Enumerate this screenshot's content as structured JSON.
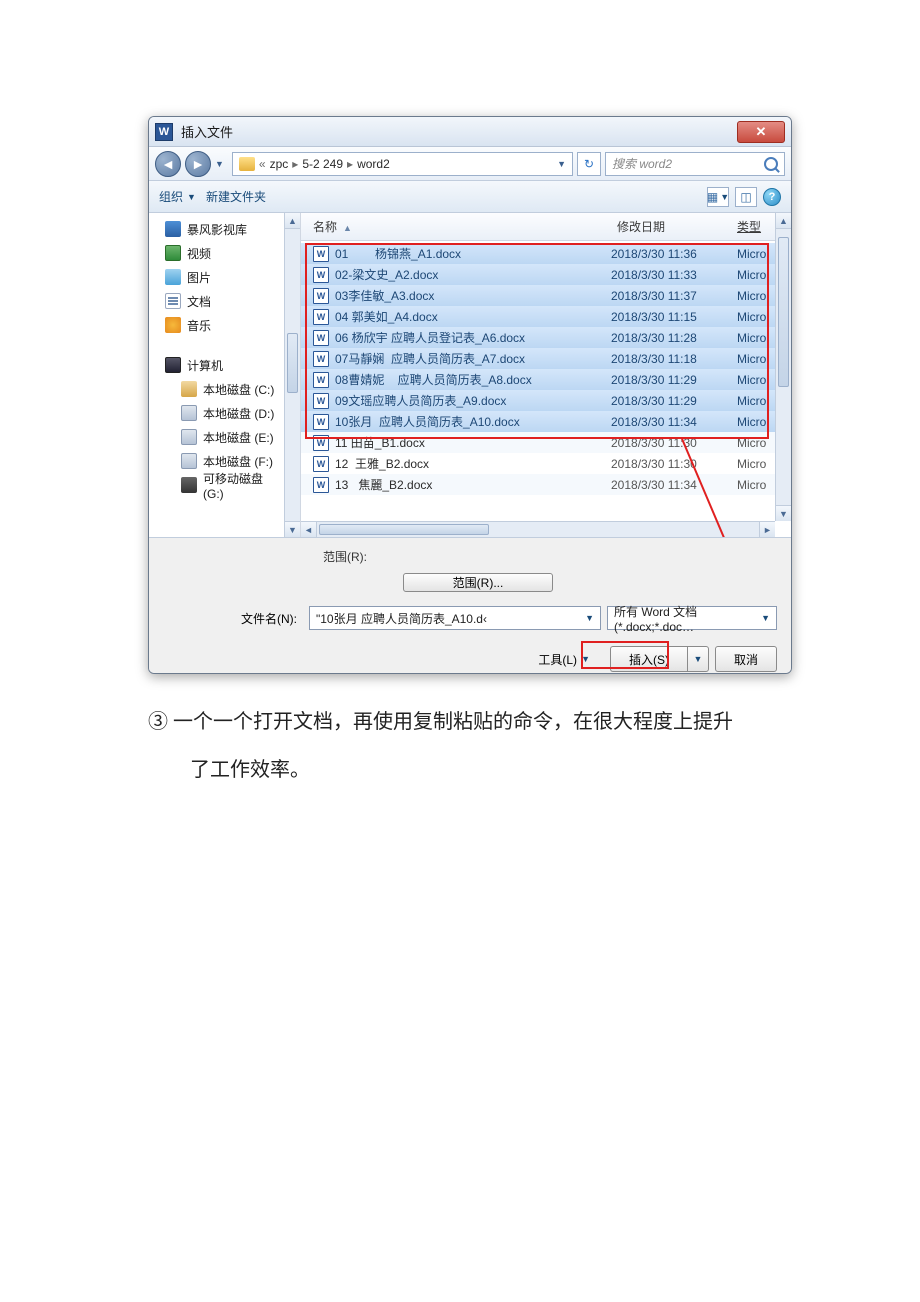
{
  "titlebar": {
    "app_label": "W",
    "title": "插入文件"
  },
  "nav": {
    "path_segments": [
      "zpc",
      "5-2 249",
      "word2"
    ],
    "search_placeholder": "搜索 word2"
  },
  "toolbar": {
    "organize": "组织",
    "new_folder": "新建文件夹"
  },
  "sidebar": {
    "items": [
      {
        "label": "暴风影视库",
        "icon": "ico-video",
        "indent": false
      },
      {
        "label": "视频",
        "icon": "ico-vid2",
        "indent": false
      },
      {
        "label": "图片",
        "icon": "ico-img",
        "indent": false
      },
      {
        "label": "文档",
        "icon": "ico-doc",
        "indent": false
      },
      {
        "label": "音乐",
        "icon": "ico-mus",
        "indent": false
      }
    ],
    "computer_label": "计算机",
    "drives": [
      {
        "label": "本地磁盘 (C:)",
        "icon": "ico-c"
      },
      {
        "label": "本地磁盘 (D:)",
        "icon": "ico-hdd"
      },
      {
        "label": "本地磁盘 (E:)",
        "icon": "ico-hdd"
      },
      {
        "label": "本地磁盘 (F:)",
        "icon": "ico-hdd"
      },
      {
        "label": "可移动磁盘 (G:)",
        "icon": "ico-usb"
      }
    ]
  },
  "filehead": {
    "name": "名称",
    "date": "修改日期",
    "type": "类型"
  },
  "files": [
    {
      "name": "01        杨锦燕_A1.docx",
      "date": "2018/3/30 11:36",
      "type": "Micro",
      "sel": true
    },
    {
      "name": "02-梁文史_A2.docx",
      "date": "2018/3/30 11:33",
      "type": "Micro",
      "sel": true
    },
    {
      "name": "03李佳敏_A3.docx",
      "date": "2018/3/30 11:37",
      "type": "Micro",
      "sel": true
    },
    {
      "name": "04 郭美如_A4.docx",
      "date": "2018/3/30 11:15",
      "type": "Micro",
      "sel": true
    },
    {
      "name": "06 杨欣宇 应聘人员登记表_A6.docx",
      "date": "2018/3/30 11:28",
      "type": "Micro",
      "sel": true
    },
    {
      "name": "07马靜娴  应聘人员简历表_A7.docx",
      "date": "2018/3/30 11:18",
      "type": "Micro",
      "sel": true
    },
    {
      "name": "08曹婧妮    应聘人员简历表_A8.docx",
      "date": "2018/3/30 11:29",
      "type": "Micro",
      "sel": true
    },
    {
      "name": "09文瑶应聘人员简历表_A9.docx",
      "date": "2018/3/30 11:29",
      "type": "Micro",
      "sel": true
    },
    {
      "name": "10张月  应聘人员简历表_A10.docx",
      "date": "2018/3/30 11:34",
      "type": "Micro",
      "sel": true
    },
    {
      "name": "11 田苗_B1.docx",
      "date": "2018/3/30 11:30",
      "type": "Micro",
      "sel": false
    },
    {
      "name": "12  王雅_B2.docx",
      "date": "2018/3/30 11:30",
      "type": "Micro",
      "sel": false
    },
    {
      "name": "13   焦麗_B2.docx",
      "date": "2018/3/30 11:34",
      "type": "Micro",
      "sel": false
    }
  ],
  "bottom": {
    "range_label": "范围(R):",
    "range_button": "范围(R)...",
    "filename_label": "文件名(N):",
    "filename_value": "\"10张月  应聘人员简历表_A10.d‹",
    "filter_value": "所有 Word 文档(*.docx;*.doc…",
    "tools": "工具(L)",
    "insert": "插入(S)",
    "cancel": "取消"
  },
  "caption": {
    "num": "③",
    "line1": "一个一个打开文档，再使用复制粘贴的命令，在很大程度上提升",
    "line2": "了工作效率。"
  }
}
